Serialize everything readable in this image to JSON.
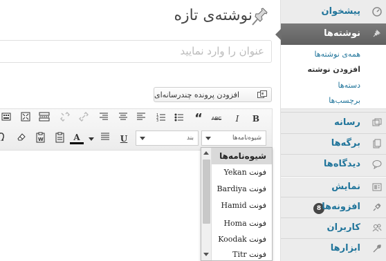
{
  "sidebar": {
    "dashboard": "پیشخوان",
    "posts": "نوشته‌ها",
    "submenu": {
      "all": "همه‌ی نوشته‌ها",
      "add_new": "افزودن نوشته",
      "categories": "دسته‌ها",
      "tags": "برچسب‌ها"
    },
    "media": "رسانه",
    "pages": "برگه‌ها",
    "comments": "دیدگاه‌ها",
    "appearance": "نمایش",
    "plugins": "افزونه‌ها",
    "plugins_badge": "8",
    "users": "کاربران",
    "tools": "ابزارها"
  },
  "main": {
    "title": "نوشته‌ی تازه",
    "title_placeholder": "عنوان را وارد نمایید",
    "media_button": "افزودن پرونده چندرسانه‌ای"
  },
  "toolbar": {
    "row1": [
      "B",
      "I",
      "ABC",
      "“",
      "bullets",
      "numbers",
      "align-left",
      "align-center",
      "align-right",
      "link",
      "unlink",
      "more",
      "fullscreen",
      "kitchen-sink"
    ],
    "row2": [
      "U",
      "justify",
      "A"
    ],
    "format_select": "شیوه‌نامه‌ها",
    "paragraph_select": "بند"
  },
  "dropdown": {
    "header": "شیوه‌نامه‌ها",
    "options": [
      "فونت Yekan",
      "فونت Bardiya",
      "فونت Hamid",
      "فونت Homa",
      "فونت Koodak",
      "فونت Titr"
    ]
  },
  "colors": {
    "link": "#21759b",
    "sidebar_bg": "#ececec",
    "active_menu": "#6e6e6e",
    "badge": "#464646"
  }
}
